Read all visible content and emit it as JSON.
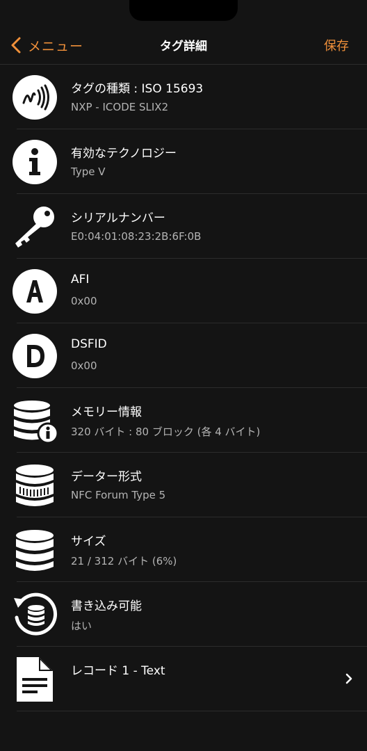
{
  "navbar": {
    "back_label": "メニュー",
    "title": "タグ詳細",
    "save_label": "保存"
  },
  "rows": [
    {
      "icon": "nfc-icon",
      "title": "タグの種類 : ISO 15693",
      "sub": "NXP - ICODE SLIX2"
    },
    {
      "icon": "info-icon",
      "title": "有効なテクノロジー",
      "sub": "Type V"
    },
    {
      "icon": "key-icon",
      "title": "シリアルナンバー",
      "sub": "E0:04:01:08:23:2B:6F:0B"
    },
    {
      "icon": "letter-a-icon",
      "title": "AFI",
      "sub": "0x00"
    },
    {
      "icon": "letter-d-icon",
      "title": "DSFID",
      "sub": "0x00"
    },
    {
      "icon": "database-info-icon",
      "title": "メモリー情報",
      "sub": "320 バイト : 80 ブロック (各 4 バイト)"
    },
    {
      "icon": "database-format-icon",
      "title": "データー形式",
      "sub": "NFC Forum Type 5"
    },
    {
      "icon": "database-icon",
      "title": "サイズ",
      "sub": "21 / 312 バイト (6%)"
    },
    {
      "icon": "database-refresh-icon",
      "title": "書き込み可能",
      "sub": "はい"
    },
    {
      "icon": "document-icon",
      "title": "レコード 1 - Text",
      "sub": ""
    }
  ],
  "colors": {
    "accent": "#f0903a",
    "background": "#141414",
    "separator": "#2c2c2c"
  }
}
